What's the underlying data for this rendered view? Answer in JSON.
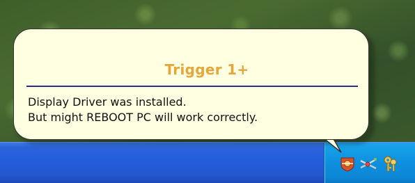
{
  "balloon": {
    "title": "Trigger 1+",
    "lines": [
      "Display Driver was installed.",
      "But might REBOOT PC will work correctly."
    ]
  },
  "tray": {
    "icons": [
      {
        "name": "trigger-app-icon"
      },
      {
        "name": "network-icon"
      },
      {
        "name": "keys-icon"
      }
    ]
  },
  "colors": {
    "title": "#e5a63b",
    "rule": "#2b2b8c",
    "balloon_bg": "#ffffe1",
    "taskbar": "#245edb",
    "tray": "#0f8fdf"
  }
}
